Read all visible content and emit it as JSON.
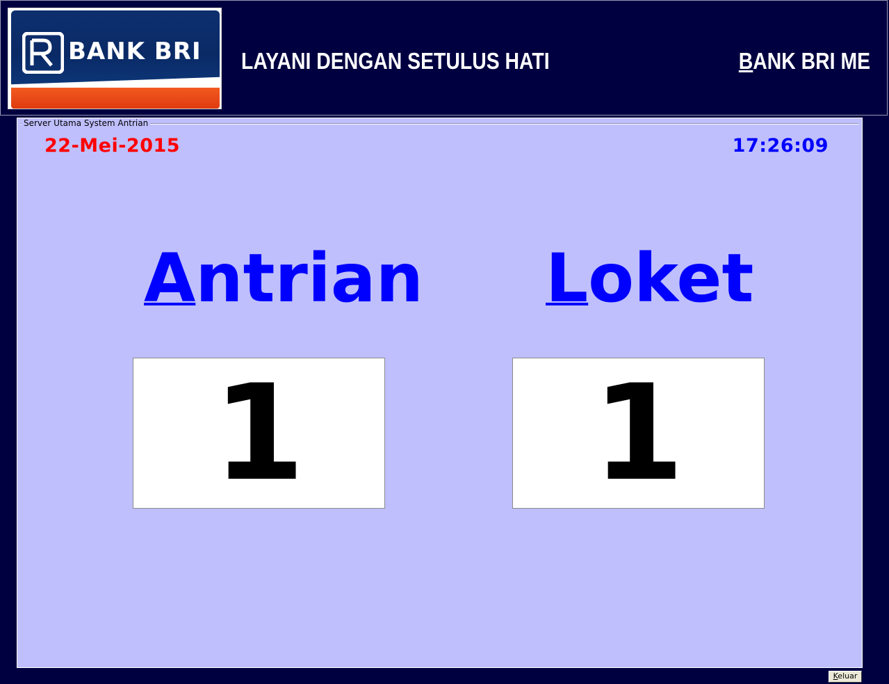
{
  "header": {
    "logo_text": "BANK BRI",
    "slogan": "LAYANI DENGAN SETULUS HATI",
    "branch_first": "B",
    "branch_rest": "ANK BRI ME"
  },
  "panel": {
    "title": "Server Utama System Antrian",
    "date": "22-Mei-2015",
    "time": "17:26:09",
    "antrian_label_first": "A",
    "antrian_label_rest": "ntrian",
    "loket_label_first": "L",
    "loket_label_rest": "oket",
    "antrian_number": "1",
    "loket_number": "1"
  },
  "footer": {
    "exit_first": "K",
    "exit_rest": "eluar"
  },
  "colors": {
    "background": "#000040",
    "panel": "#bfbffd",
    "date": "#ff0000",
    "time": "#0000ff",
    "labels": "#0000ff",
    "brand_orange": "#f25a20",
    "brand_blue": "#0a2a66"
  }
}
